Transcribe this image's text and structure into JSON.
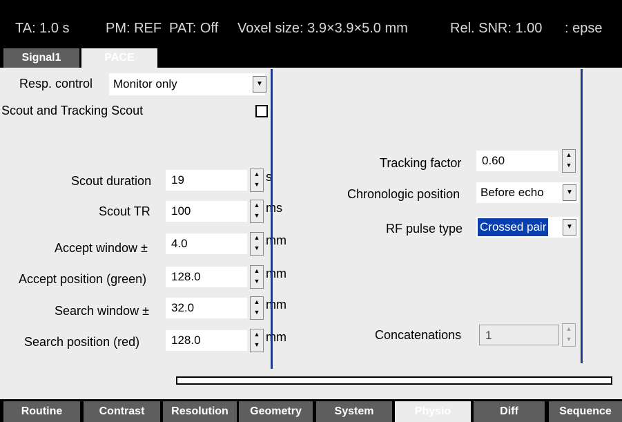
{
  "status_bar": {
    "ta": "TA: 1.0 s",
    "pm": "PM: REF",
    "pat": "PAT: Off",
    "voxel": "Voxel size: 3.9×3.9×5.0 mm",
    "snr": "Rel. SNR: 1.00",
    "seq": ": epse"
  },
  "tabs": {
    "signal": "Signal1",
    "pace": "PACE"
  },
  "left": {
    "resp_label": "Resp. control",
    "resp_value": "Monitor only",
    "scout_label": "Scout and Tracking Scout",
    "scout_checked": false,
    "rows": [
      {
        "label": "Scout duration",
        "value": "19",
        "unit": "s"
      },
      {
        "label": "Scout TR",
        "value": "100",
        "unit": "ms"
      },
      {
        "label": "Accept window ±",
        "value": "4.0",
        "unit": "mm"
      },
      {
        "label": "Accept position (green)",
        "value": "128.0",
        "unit": "mm"
      },
      {
        "label": "Search window ±",
        "value": "32.0",
        "unit": "mm"
      },
      {
        "label": "Search position (red)",
        "value": "128.0",
        "unit": "mm"
      }
    ]
  },
  "right": {
    "tracking_label": "Tracking factor",
    "tracking_value": "0.60",
    "chrono_label": "Chronologic position",
    "chrono_value": "Before echo",
    "rf_label": "RF pulse type",
    "rf_value": "Crossed pair",
    "concat_label": "Concatenations",
    "concat_value": "1"
  },
  "bottom_tabs": [
    "Routine",
    "Contrast",
    "Resolution",
    "Geometry",
    "System",
    "Physio",
    "Diff",
    "Sequence"
  ],
  "active_bottom_tab": "Physio",
  "colors": {
    "divider": "#1e3a8a",
    "selection": "#0a3fb0",
    "panel": "#ececec"
  }
}
